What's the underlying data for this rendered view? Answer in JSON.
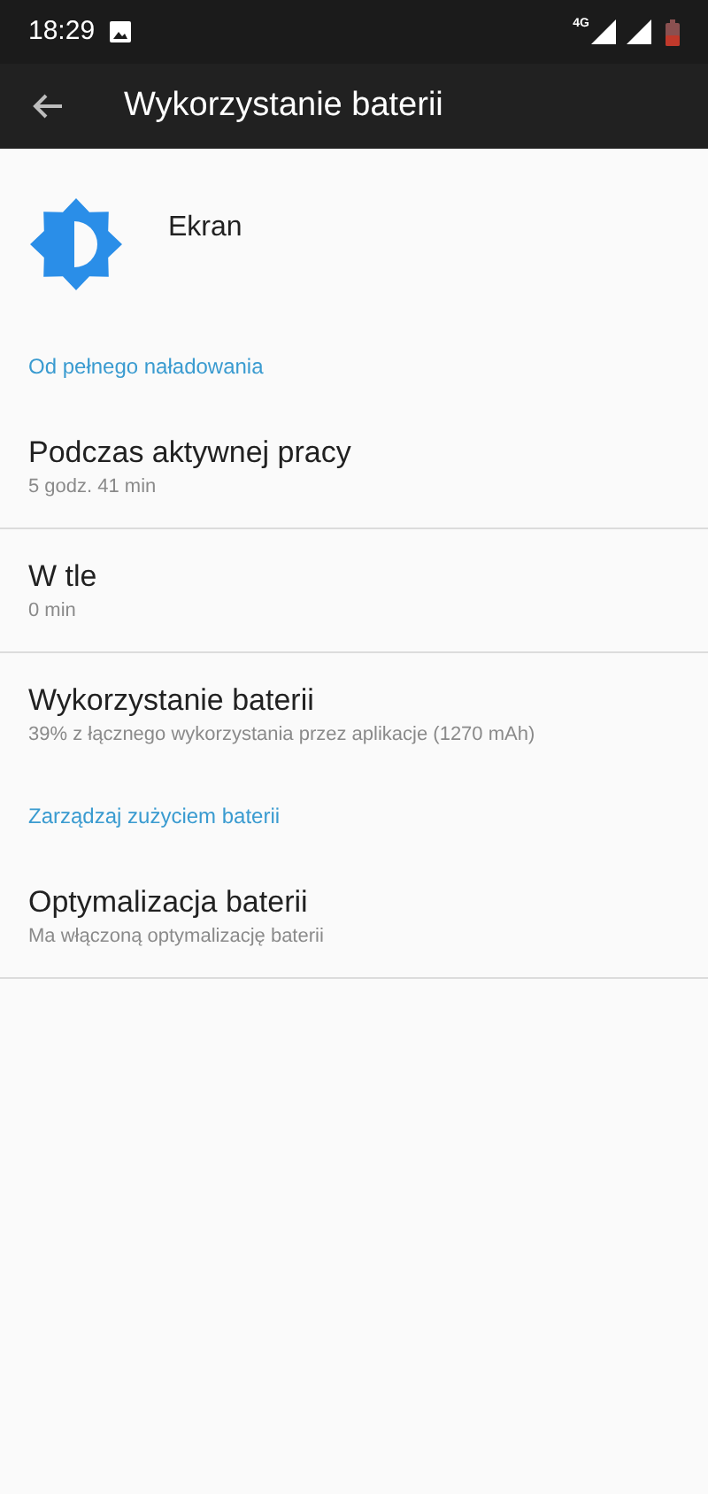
{
  "status_bar": {
    "time": "18:29",
    "network": "4G"
  },
  "toolbar": {
    "title": "Wykorzystanie baterii"
  },
  "header": {
    "title": "Ekran"
  },
  "list": [
    {
      "kind": "category",
      "title": "Od pełnego naładowania"
    },
    {
      "kind": "item",
      "title": "Podczas aktywnej pracy",
      "summary": "5 godz. 41 min",
      "divider": true
    },
    {
      "kind": "item",
      "title": "W tle",
      "summary": "0 min",
      "divider": true
    },
    {
      "kind": "item",
      "title": "Wykorzystanie baterii",
      "summary": "39% z łącznego wykorzystania przez aplikacje (1270 mAh)",
      "divider": false
    },
    {
      "kind": "category",
      "title": "Zarządzaj zużyciem baterii"
    },
    {
      "kind": "item",
      "title": "Optymalizacja baterii",
      "summary": "Ma włączoną optymalizację baterii",
      "divider": true
    }
  ]
}
